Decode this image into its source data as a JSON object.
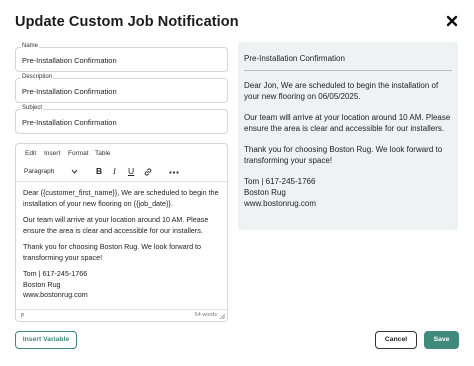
{
  "dialog": {
    "title": "Update Custom Job Notification",
    "close_icon": "close-icon"
  },
  "fields": {
    "name": {
      "label": "Name",
      "value": "Pre-Installation Confirmation"
    },
    "description": {
      "label": "Description",
      "value": "Pre-Installation Confirmation"
    },
    "subject": {
      "label": "Subject",
      "value": "Pre-Installation Confirmation"
    }
  },
  "editor": {
    "menu": [
      "Edit",
      "Insert",
      "Format",
      "Table"
    ],
    "block_format": "Paragraph",
    "toolbar_icons": [
      "chevron-down-icon",
      "bold-icon",
      "italic-icon",
      "underline-icon",
      "link-icon",
      "more-icon"
    ],
    "content": {
      "p1": "Dear {{customer_first_name}}, We are scheduled to begin the installation of your new flooring on {{job_date}}.",
      "p2": "Our team will arrive at your location around 10 AM.  Please ensure the area is clear and accessible for our installers.",
      "p3": "Thank you for choosing Boston Rug. We look forward to transforming your space!",
      "sig1": "Tom | 617-245-1766",
      "sig2": "Boston Rug",
      "sig3": "www.bostonrug.com"
    },
    "status_path": "p",
    "word_count": "54 words"
  },
  "preview": {
    "subject": "Pre-Installation Confirmation",
    "p1": "Dear Jon, We are scheduled to begin the installation of your new flooring on 06/05/2025.",
    "p2": "Our team will arrive at your location around 10 AM. Please ensure the area is clear and accessible for our installers.",
    "p3": "Thank you for choosing Boston Rug. We look forward to transforming your space!",
    "sig1": "Tom | 617-245-1766",
    "sig2": "Boston Rug",
    "sig3": "www.bostonrug.com"
  },
  "buttons": {
    "insert_variable": "Insert Variable",
    "cancel": "Cancel",
    "save": "Save"
  },
  "colors": {
    "accent": "#3f8a7a",
    "preview_bg": "#f0f1f3"
  }
}
